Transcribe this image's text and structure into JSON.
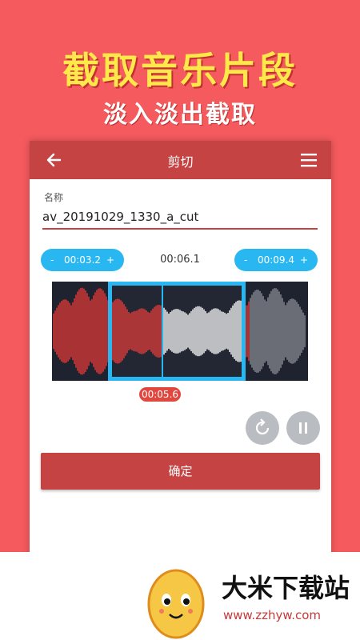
{
  "promo": {
    "title": "截取音乐片段",
    "subtitle": "淡入淡出截取"
  },
  "appbar": {
    "title": "剪切",
    "back_icon": "arrow-left-icon",
    "menu_icon": "hamburger-menu-icon"
  },
  "form": {
    "name_label": "名称",
    "name_value": "av_20191029_1330_a_cut"
  },
  "trim": {
    "start": {
      "minus": "-",
      "value": "00:03.2",
      "plus": "+"
    },
    "duration": "00:06.1",
    "end": {
      "minus": "-",
      "value": "00:09.4",
      "plus": "+"
    },
    "playhead": "00:05.6"
  },
  "controls": {
    "reset_icon": "reset-icon",
    "pause_icon": "pause-icon",
    "confirm_label": "确定"
  },
  "brand": {
    "name": "大米下载站",
    "url": "www.zzhyw.com"
  },
  "colors": {
    "background": "#f45a5e",
    "appbar": "#c54343",
    "accent_blue": "#29b7f2",
    "waveform_red": "#e53935",
    "waveform_white": "#ffffff",
    "waveform_gray": "#8a8d93"
  }
}
